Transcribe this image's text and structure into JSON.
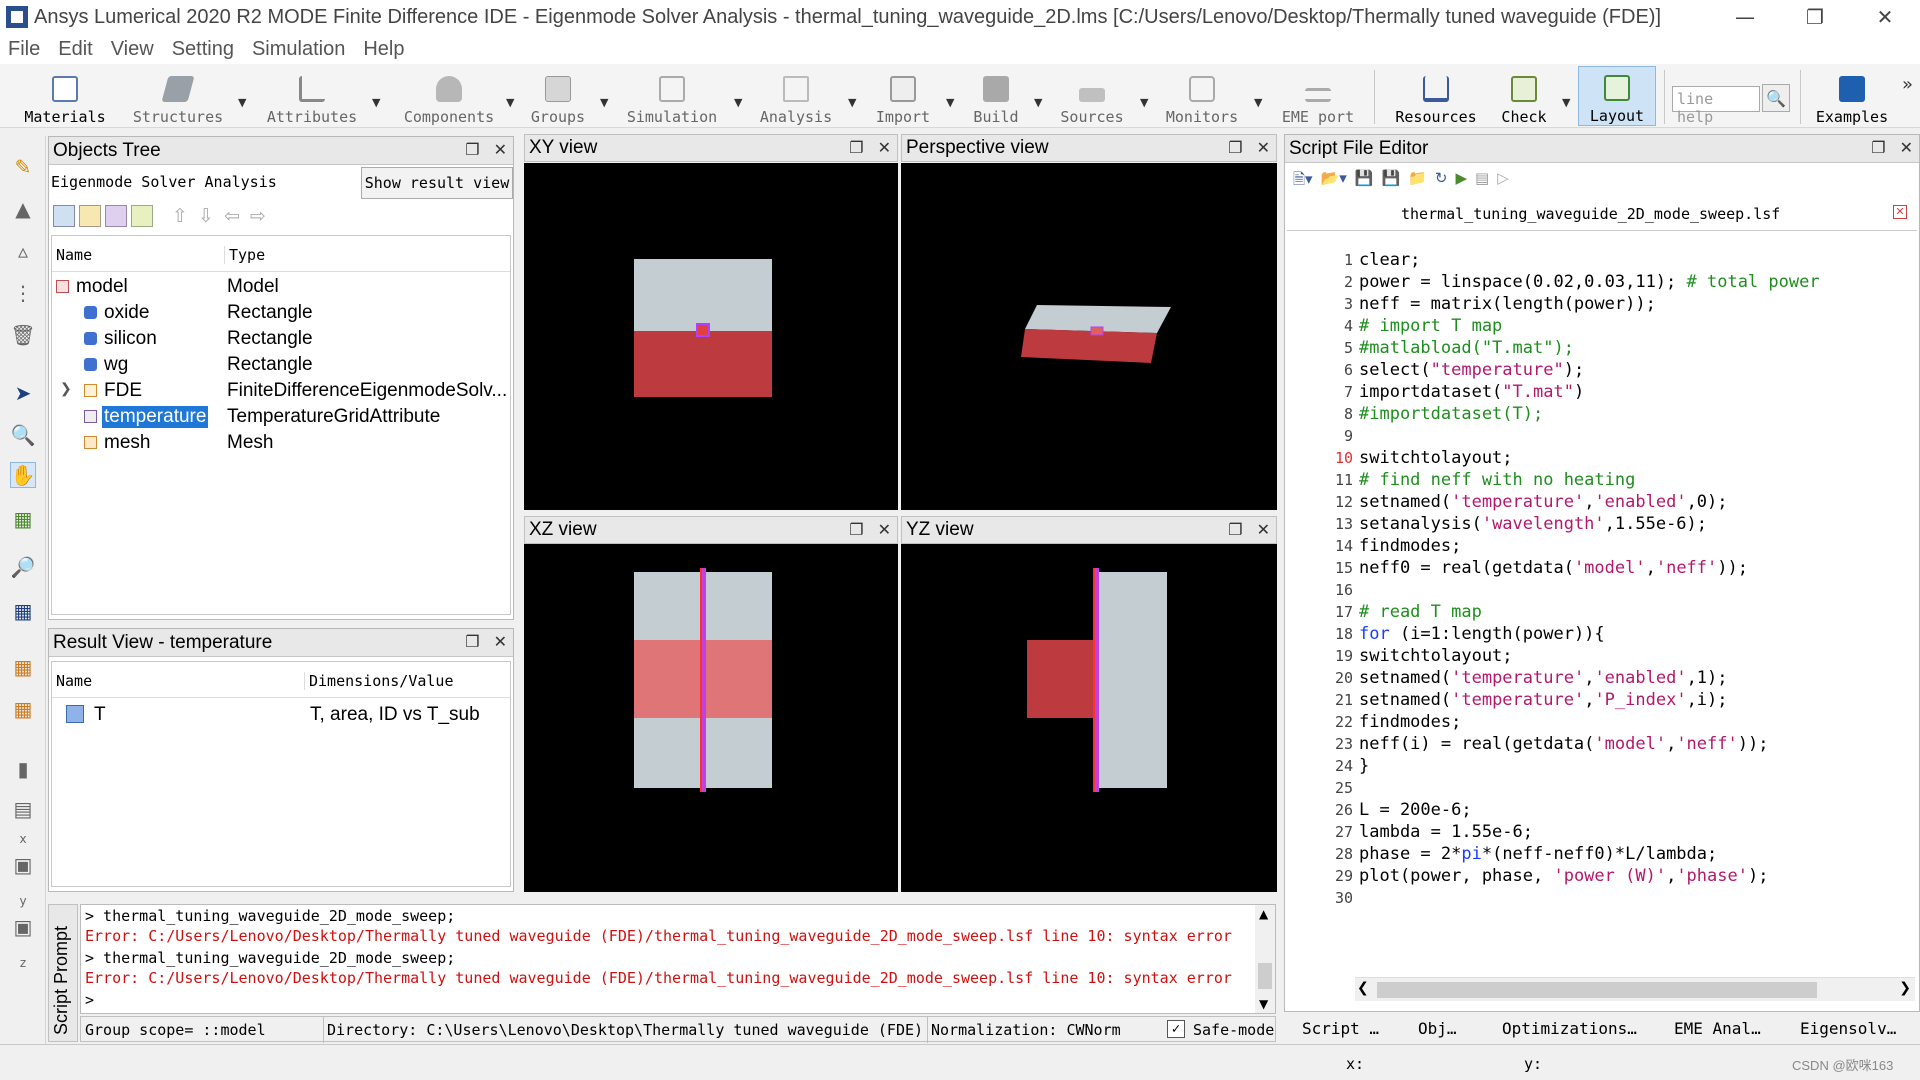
{
  "window": {
    "title": "Ansys Lumerical 2020 R2 MODE Finite Difference IDE - Eigenmode Solver Analysis - thermal_tuning_waveguide_2D.lms [C:/Users/Lenovo/Desktop/Thermally tuned waveguide (FDE)]"
  },
  "menu": [
    "File",
    "Edit",
    "View",
    "Setting",
    "Simulation",
    "Help"
  ],
  "toolbar": {
    "items": [
      "Materials",
      "Structures",
      "Attributes",
      "Components",
      "Groups",
      "Simulation",
      "Analysis",
      "Import",
      "Build",
      "Sources",
      "Monitors",
      "EME port",
      "Resources",
      "Check",
      "Layout",
      "Examples"
    ],
    "line_help_placeholder": "line help"
  },
  "objects_tree": {
    "title": "Objects Tree",
    "mode_label": "Eigenmode Solver Analysis",
    "show_result_button": "Show result view",
    "columns": [
      "Name",
      "Type"
    ],
    "rows": [
      {
        "name": "model",
        "type": "Model"
      },
      {
        "name": "oxide",
        "type": "Rectangle"
      },
      {
        "name": "silicon",
        "type": "Rectangle"
      },
      {
        "name": "wg",
        "type": "Rectangle"
      },
      {
        "name": "FDE",
        "type": "FiniteDifferenceEigenmodeSolv..."
      },
      {
        "name": "temperature",
        "type": "TemperatureGridAttribute"
      },
      {
        "name": "mesh",
        "type": "Mesh"
      }
    ]
  },
  "result_view": {
    "title": "Result View - temperature",
    "columns": [
      "Name",
      "Dimensions/Value"
    ],
    "rows": [
      {
        "name": "T",
        "value": "T, area, ID vs T_sub"
      }
    ]
  },
  "views": {
    "xy": "XY view",
    "perspective": "Perspective view",
    "xz": "XZ view",
    "yz": "YZ view"
  },
  "script_editor": {
    "title": "Script File Editor",
    "filename": "thermal_tuning_waveguide_2D_mode_sweep.lsf"
  },
  "console": {
    "side_label": "Script Prompt",
    "lines": [
      "> thermal_tuning_waveguide_2D_mode_sweep;",
      "Error: C:/Users/Lenovo/Desktop/Thermally tuned waveguide (FDE)/thermal_tuning_waveguide_2D_mode_sweep.lsf line 10: syntax error",
      "> thermal_tuning_waveguide_2D_mode_sweep;",
      "Error: C:/Users/Lenovo/Desktop/Thermally tuned waveguide (FDE)/thermal_tuning_waveguide_2D_mode_sweep.lsf line 10: syntax error",
      ">"
    ]
  },
  "status": {
    "group_scope": "Group scope= ::model",
    "directory": "Directory: C:\\Users\\Lenovo\\Desktop\\Thermally tuned waveguide (FDE)",
    "normalization": "Normalization: CWNorm",
    "safe_mode": "Safe-mode"
  },
  "bottom_tabs": [
    "Script …",
    "Obj…",
    "Optimizations…",
    "EME Anal…",
    "Eigensolv…"
  ],
  "coords": {
    "x": "x:",
    "y": "y:"
  },
  "watermark": "CSDN @欧咪163"
}
